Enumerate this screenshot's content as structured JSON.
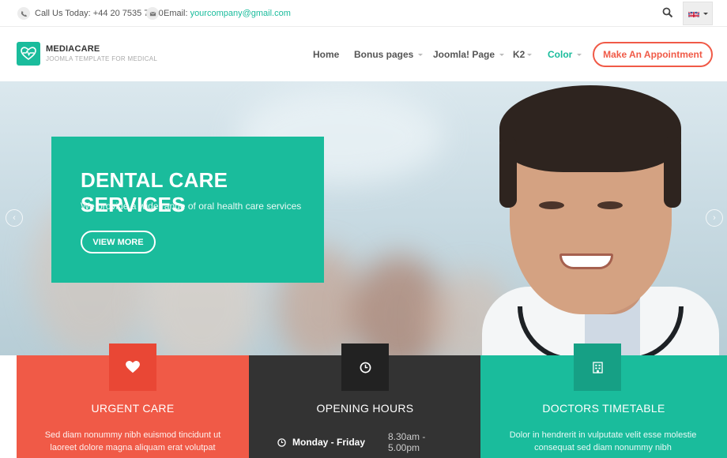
{
  "topbar": {
    "phone_label": "Call Us Today: +44 20 7535 7500",
    "email_label": "Email:",
    "email": "yourcompany@gmail.com"
  },
  "header": {
    "brand": "MEDIACARE",
    "tagline": "JOOMLA TEMPLATE FOR MEDICAL",
    "nav": [
      "Home",
      "Bonus pages",
      "Joomla! Page",
      "K2",
      "Color"
    ],
    "cta": "Make An Appointment"
  },
  "hero": {
    "title": "DENTAL CARE SERVICES",
    "subtitle": "We provide a wide range of oral health care services",
    "button": "VIEW MORE"
  },
  "cards": [
    {
      "title": "URGENT CARE",
      "text": "Sed diam nonummy nibh euismod tincidunt ut laoreet dolore magna aliquam erat volutpat",
      "icon": "heart-icon",
      "color": "#f05a47"
    },
    {
      "title": "OPENING HOURS",
      "day": "Monday - Friday",
      "time": "8.30am - 5.00pm",
      "icon": "clock-icon",
      "color": "#333333"
    },
    {
      "title": "DOCTORS TIMETABLE",
      "text": "Dolor in hendrerit in vulputate velit esse molestie consequat sed diam nonummy nibh",
      "icon": "timetable-icon",
      "color": "#1abc9c"
    }
  ],
  "colors": {
    "accent": "#1abc9c",
    "danger": "#f05a47",
    "dark": "#333333"
  }
}
